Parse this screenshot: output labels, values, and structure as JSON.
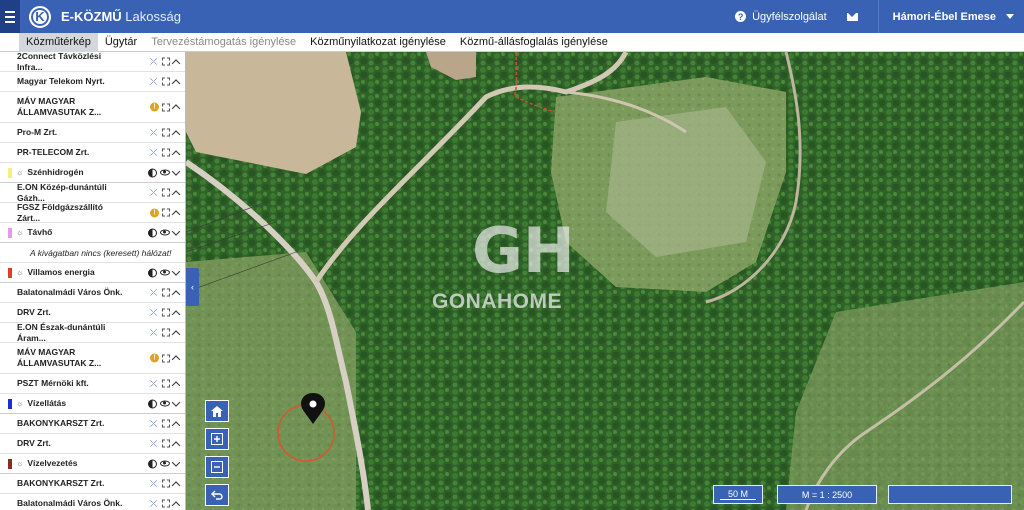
{
  "header": {
    "logo_letter": "K",
    "app_name": "E-KÖZMŰ",
    "app_section": "Lakosság",
    "help_label": "Ügyfélszolgálat",
    "user_name": "Hámori-Ébel Emese"
  },
  "tabs": [
    {
      "label": "Közműtérkép",
      "state": "active"
    },
    {
      "label": "Ügytár",
      "state": "normal"
    },
    {
      "label": "Tervezéstámogatás igénylése",
      "state": "disabled"
    },
    {
      "label": "Közműnyilatkozat igénylése",
      "state": "normal"
    },
    {
      "label": "Közmű-állásfoglalás igénylése",
      "state": "normal"
    }
  ],
  "sidebar": {
    "items": [
      {
        "type": "item",
        "label": "2Connect Távközlési Infra...",
        "warn": false
      },
      {
        "type": "item",
        "label": "Magyar Telekom Nyrt.",
        "warn": false
      },
      {
        "type": "item2",
        "label": "MÁV MAGYAR ÁLLAMVASUTAK Z...",
        "warn": true
      },
      {
        "type": "item",
        "label": "Pro-M Zrt.",
        "warn": false
      },
      {
        "type": "item",
        "label": "PR-TELECOM Zrt.",
        "warn": false
      },
      {
        "type": "group",
        "label": "Szénhidrogén",
        "color": "#f5f07a",
        "icon": "gas-icon"
      },
      {
        "type": "item",
        "label": "E.ON Közép-dunántúli Gázh...",
        "warn": false
      },
      {
        "type": "item",
        "label": "FGSZ Földgázszállító Zárt...",
        "warn": true
      },
      {
        "type": "group",
        "label": "Távhő",
        "color": "#e69ae6",
        "icon": "sun-icon"
      },
      {
        "type": "note",
        "label": "A kivágatban nincs (keresett) hálózat!"
      },
      {
        "type": "group",
        "label": "Villamos energia",
        "color": "#e23b2e",
        "icon": "bolt-icon"
      },
      {
        "type": "item",
        "label": "Balatonalmádi Város Önk.",
        "warn": false
      },
      {
        "type": "item",
        "label": "DRV Zrt.",
        "warn": false
      },
      {
        "type": "item",
        "label": "E.ON Észak-dunántúli Áram...",
        "warn": false
      },
      {
        "type": "item2",
        "label": "MÁV MAGYAR ÁLLAMVASUTAK Z...",
        "warn": true
      },
      {
        "type": "item",
        "label": "PSZT Mérnöki kft.",
        "warn": false
      },
      {
        "type": "group",
        "label": "Vízellátás",
        "color": "#1b2fd6",
        "icon": "drop-icon"
      },
      {
        "type": "item",
        "label": "BAKONYKARSZT Zrt.",
        "warn": false
      },
      {
        "type": "item",
        "label": "DRV Zrt.",
        "warn": false
      },
      {
        "type": "group",
        "label": "Vízelvezetés",
        "color": "#8b2b1f",
        "icon": "drain-icon"
      },
      {
        "type": "item",
        "label": "BAKONYKARSZT Zrt.",
        "warn": false
      },
      {
        "type": "item",
        "label": "Balatonalmádi Város Önk.",
        "warn": false
      }
    ]
  },
  "map": {
    "watermark": "GONAHOME",
    "watermark_monogram": "GH",
    "scale_bar_label": "50 M",
    "scale_ratio_label": "M = 1 : 2500",
    "coordinates_label": ""
  },
  "colors": {
    "primary": "#3a62b4",
    "warn": "#e1a21d"
  }
}
